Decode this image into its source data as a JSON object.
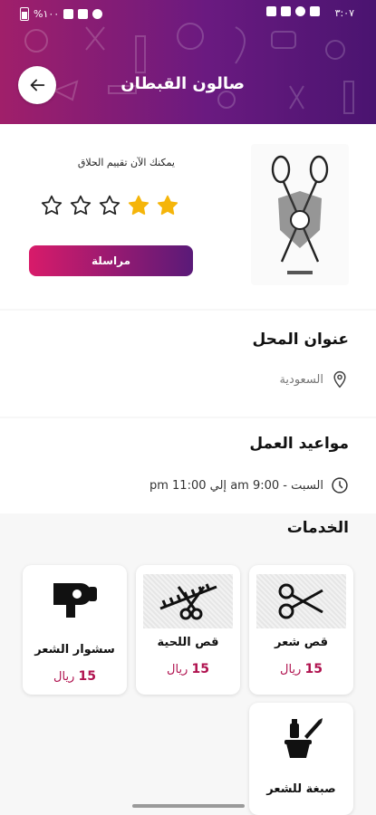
{
  "status_bar": {
    "time": "٣:٠٧",
    "battery": "%١٠٠"
  },
  "header": {
    "title": "صالون القبطان",
    "back_icon": "arrow-left-icon"
  },
  "profile": {
    "rate_prompt": "يمكنك الآن تقييم الحلاق",
    "rating": 2,
    "rating_max": 5,
    "star_color": "#f5b50a",
    "message_button": "مراسلة",
    "logo_icon": "scissors-emblem-icon"
  },
  "address": {
    "title": "عنوان المحل",
    "value": "السعودية",
    "icon": "location-pin-icon"
  },
  "hours": {
    "title": "مواعيد العمل",
    "value": "السبت - 9:00 am إلي 11:00 pm",
    "icon": "clock-icon"
  },
  "services": {
    "title": "الخدمات",
    "items": [
      {
        "name": "قص شعر",
        "price": "15",
        "currency": "ريال",
        "icon": "scissors-icon"
      },
      {
        "name": "قص اللحية",
        "price": "15",
        "currency": "ريال",
        "icon": "comb-scissors-icon"
      },
      {
        "name": "سشوار الشعر",
        "price": "15",
        "currency": "ريال",
        "icon": "hair-dryer-icon"
      },
      {
        "name": "صبغة للشعر",
        "icon": "hair-dye-icon"
      }
    ]
  },
  "colors": {
    "accent_start": "#d81b6a",
    "accent_end": "#5a1a78",
    "price": "#b0124f"
  }
}
